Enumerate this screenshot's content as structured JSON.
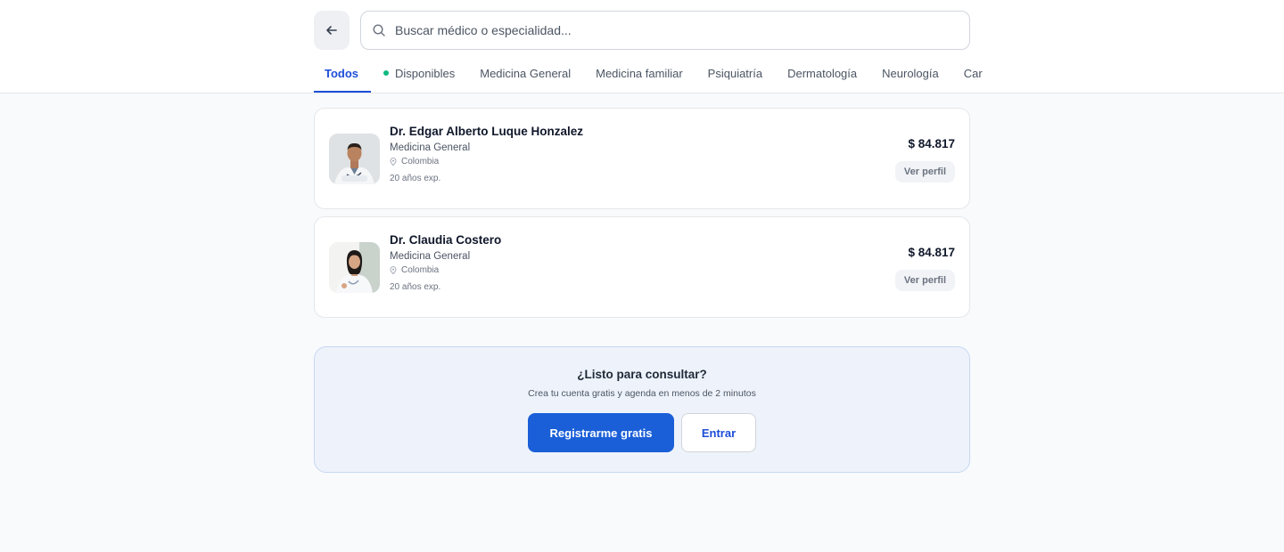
{
  "search": {
    "placeholder": "Buscar médico o especialidad..."
  },
  "tabs": [
    {
      "label": "Todos",
      "active": true
    },
    {
      "label": "Disponibles",
      "dot_color": "#10b981"
    },
    {
      "label": "Medicina General"
    },
    {
      "label": "Medicina familiar"
    },
    {
      "label": "Psiquiatría"
    },
    {
      "label": "Dermatología"
    },
    {
      "label": "Neurología"
    },
    {
      "label": "Car"
    }
  ],
  "doctors": [
    {
      "name": "Dr. Edgar Alberto Luque Honzalez",
      "specialty": "Medicina General",
      "location": "Colombia",
      "experience": "20 años exp.",
      "price": "$ 84.817",
      "profile_label": "Ver perfil"
    },
    {
      "name": "Dr. Claudia Costero",
      "specialty": "Medicina General",
      "location": "Colombia",
      "experience": "20 años exp.",
      "price": "$ 84.817",
      "profile_label": "Ver perfil"
    }
  ],
  "cta": {
    "title": "¿Listo para consultar?",
    "subtitle": "Crea tu cuenta gratis y agenda en menos de 2 minutos",
    "primary_label": "Registrarme gratis",
    "secondary_label": "Entrar"
  },
  "colors": {
    "accent": "#1a5fd8",
    "available_dot": "#10b981"
  },
  "icons": {
    "back": "arrow-left-icon",
    "search": "search-icon",
    "location": "map-pin-icon"
  }
}
